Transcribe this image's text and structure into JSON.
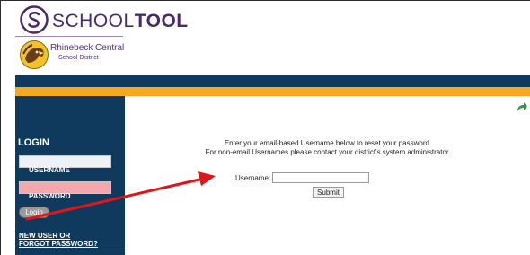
{
  "header": {
    "logo_prefix": "SCHOOL",
    "logo_bold": "TOOL",
    "district_name": "Rhinebeck Central",
    "district_sub": "School District"
  },
  "sidebar": {
    "login_title": "LOGIN",
    "username_label": "USERNAME",
    "password_label": "PASSWORD",
    "login_button": "Login",
    "new_user_line1": "NEW USER OR",
    "new_user_line2": "FORGOT PASSWORD?"
  },
  "main": {
    "instruction_line1": "Enter your email-based Username below to reset your password.",
    "instruction_line2": "For non-email Usernames please contact your district's system administrator.",
    "username_label": "Username:",
    "username_value": "",
    "submit_button": "Submit"
  },
  "colors": {
    "navy": "#0f3a5e",
    "gold": "#f6a821",
    "password_field": "#f3a8ad",
    "annotation_arrow": "#e0151a",
    "refresh_icon": "#2e9b3a"
  }
}
